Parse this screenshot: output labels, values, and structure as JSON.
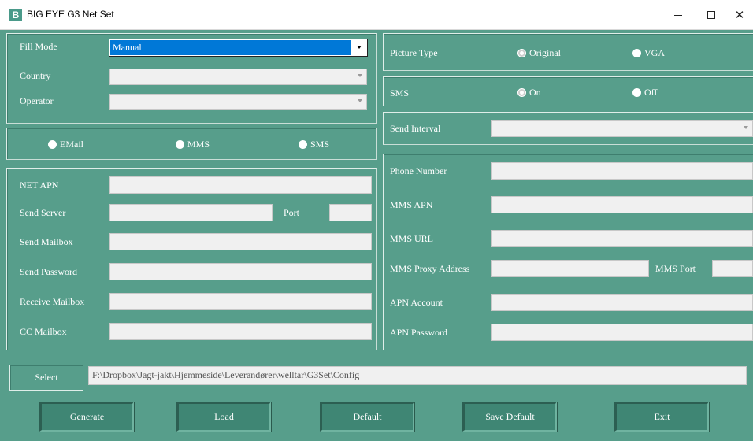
{
  "window": {
    "title": "BIG EYE G3 Net Set",
    "icon_letter": "B",
    "minimize": "—",
    "maximize": "",
    "close": "✕"
  },
  "fill_group": {
    "fill_mode_label": "Fill Mode",
    "fill_mode_value": "Manual",
    "country_label": "Country",
    "country_value": "",
    "operator_label": "Operator",
    "operator_value": ""
  },
  "send_mode": {
    "options": [
      "EMail",
      "MMS",
      "SMS"
    ],
    "selected": ""
  },
  "email_group": {
    "net_apn_label": "NET APN",
    "net_apn_value": "",
    "send_server_label": "Send Server",
    "send_server_value": "",
    "port_label": "Port",
    "port_value": "",
    "send_mailbox_label": "Send Mailbox",
    "send_mailbox_value": "",
    "send_password_label": "Send Password",
    "send_password_value": "",
    "receive_mailbox_label": "Receive Mailbox",
    "receive_mailbox_value": "",
    "cc_mailbox_label": "CC Mailbox",
    "cc_mailbox_value": ""
  },
  "picture_type": {
    "label": "Picture Type",
    "options": [
      "Original",
      "VGA"
    ],
    "selected": "Original"
  },
  "sms": {
    "label": "SMS",
    "options": [
      "On",
      "Off"
    ],
    "selected": "On"
  },
  "send_interval": {
    "label": "Send Interval",
    "value": ""
  },
  "mms_group": {
    "phone_number_label": "Phone Number",
    "phone_number_value": "",
    "mms_apn_label": "MMS APN",
    "mms_apn_value": "",
    "mms_url_label": "MMS URL",
    "mms_url_value": "",
    "mms_proxy_label": "MMS Proxy Address",
    "mms_proxy_value": "",
    "mms_port_label": "MMS Port",
    "mms_port_value": "",
    "apn_account_label": "APN Account",
    "apn_account_value": "",
    "apn_password_label": "APN Password",
    "apn_password_value": ""
  },
  "path": {
    "select_label": "Select",
    "value": "F:\\Dropbox\\Jagt-jakt\\Hjemmeside\\Leverandører\\welltar\\G3Set\\Config"
  },
  "buttons": {
    "generate": "Generate",
    "load": "Load",
    "default": "Default",
    "save_default": "Save Default",
    "exit": "Exit"
  },
  "colors": {
    "background": "#579e8b",
    "selection": "#0078d7"
  }
}
